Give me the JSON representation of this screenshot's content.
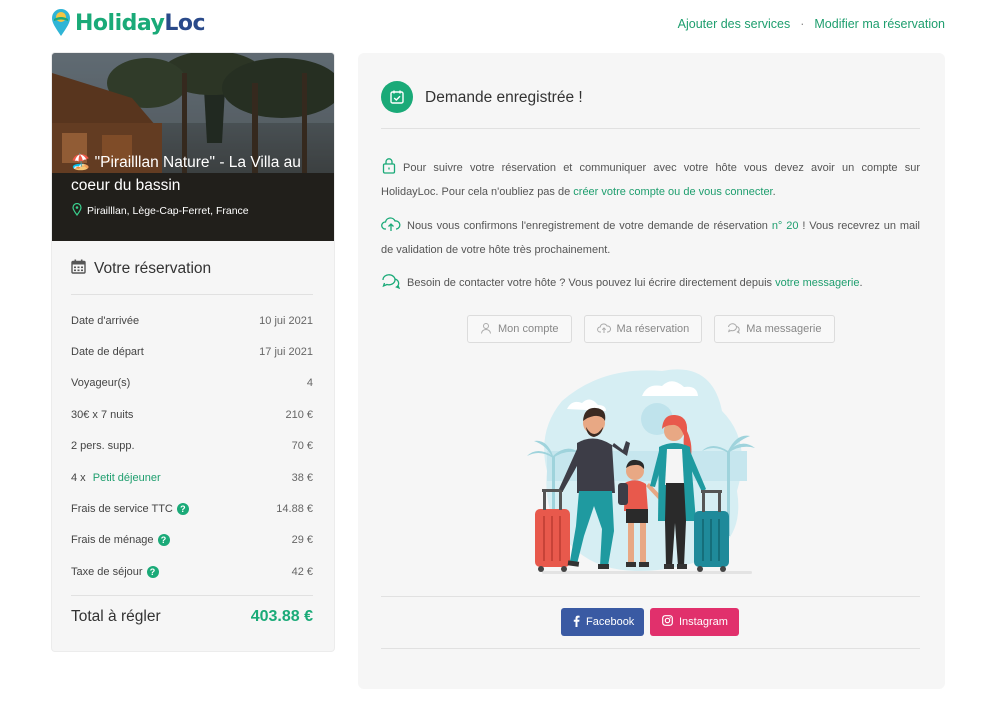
{
  "header": {
    "logo_part1": "Holiday",
    "logo_part2": "Loc",
    "nav": {
      "add_services": "Ajouter des services",
      "separator": "·",
      "modify": "Modifier ma réservation"
    }
  },
  "property": {
    "emoji": "🏖️",
    "title": "\"Pirailllan Nature\" - La Villa au coeur du bassin",
    "location": "Pirailllan, Lège-Cap-Ferret, France"
  },
  "reservation": {
    "heading": "Votre réservation",
    "rows": [
      {
        "label": "Date d'arrivée",
        "value": "10 jui 2021"
      },
      {
        "label": "Date de départ",
        "value": "17 jui 2021"
      },
      {
        "label": "Voyageur(s)",
        "value": "4"
      },
      {
        "label": "30€ x 7 nuits",
        "value": "210 €"
      },
      {
        "label": "2 pers. supp.",
        "value": "70 €"
      },
      {
        "label_prefix": "4 x ",
        "label_link": "Petit déjeuner",
        "value": "38 €"
      },
      {
        "label": "Frais de service TTC",
        "value": "14.88 €",
        "help": "?"
      },
      {
        "label": "Frais de ménage",
        "value": "29 €",
        "help": "?"
      },
      {
        "label": "Taxe de séjour",
        "value": "42 €",
        "help": "?"
      }
    ],
    "total_label": "Total à régler",
    "total_value": "403.88 €"
  },
  "confirmation": {
    "title": "Demande enregistrée !",
    "para1_text": "Pour suivre votre réservation et communiquer avec votre hôte vous devez avoir un compte sur HolidayLoc. Pour cela n'oubliez pas de ",
    "para1_link": "créer votre compte ou de vous connecter",
    "para1_end": ".",
    "para2_text": "Nous vous confirmons l'enregistrement de votre demande de réservation ",
    "para2_link": "n° 20",
    "para2_end": " ! Vous recevrez un mail de validation de votre hôte très prochainement.",
    "para3_text": "Besoin de contacter votre hôte ? Vous pouvez lui écrire directement depuis ",
    "para3_link": "votre messagerie",
    "para3_end": ".",
    "buttons": {
      "account": "Mon compte",
      "reservation": "Ma réservation",
      "messages": "Ma messagerie"
    },
    "social": {
      "facebook": "Facebook",
      "instagram": "Instagram"
    }
  },
  "colors": {
    "brand_green": "#1aaa78",
    "brand_blue": "#2a4a8a",
    "facebook": "#3a5aa3",
    "instagram": "#e1306c"
  }
}
